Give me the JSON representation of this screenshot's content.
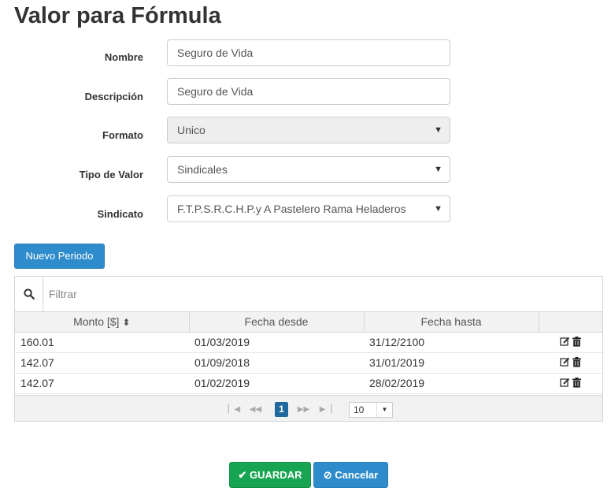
{
  "page": {
    "title": "Valor para Fórmula"
  },
  "form": {
    "nombre": {
      "label": "Nombre",
      "value": "Seguro de Vida"
    },
    "descripcion": {
      "label": "Descripción",
      "value": "Seguro de Vida"
    },
    "formato": {
      "label": "Formato",
      "value": "Unico",
      "disabled": true
    },
    "tipo_valor": {
      "label": "Tipo de Valor",
      "value": "Sindicales"
    },
    "sindicato": {
      "label": "Sindicato",
      "value": "F.T.P.S.R.C.H.P.y A Pastelero Rama Heladeros"
    }
  },
  "actions": {
    "new_period_label": "Nuevo Periodo"
  },
  "grid": {
    "filter_placeholder": "Filtrar",
    "columns": [
      "Monto [$]",
      "Fecha desde",
      "Fecha hasta",
      ""
    ],
    "sort_indicator": "⬍",
    "rows": [
      {
        "monto": "160.01",
        "desde": "01/03/2019",
        "hasta": "31/12/2100"
      },
      {
        "monto": "142.07",
        "desde": "01/09/2018",
        "hasta": "31/01/2019"
      },
      {
        "monto": "142.07",
        "desde": "01/02/2019",
        "hasta": "28/02/2019"
      }
    ],
    "pager": {
      "current_page": "1",
      "page_size": "10"
    }
  },
  "footer": {
    "save_label": "GUARDAR",
    "cancel_label": "Cancelar"
  },
  "colors": {
    "primary": "#2f8ccc",
    "success": "#18a553",
    "pager_active": "#20699e"
  }
}
